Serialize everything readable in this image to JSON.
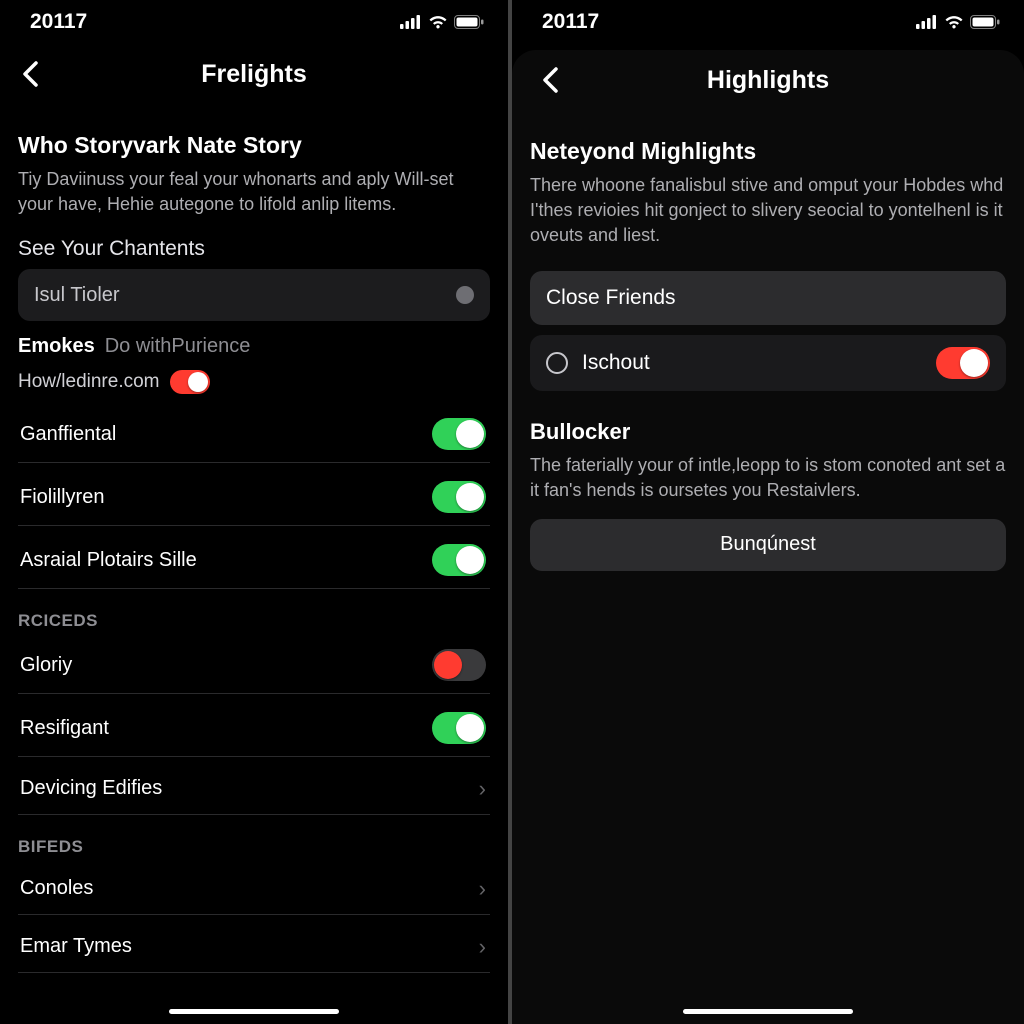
{
  "left": {
    "status_time": "20117",
    "nav_title": "Freliġhts",
    "section1_title": "Who Storyvark Nate Story",
    "section1_desc": "Tiy Daviinuss your feal your whonarts and aply Will-set your have, Hehie autegone to lifold anlip litems.",
    "subhead": "See Your Chantents",
    "cell_isul": "Isul Tioler",
    "emokes_strong": "Emokes",
    "emokes_grey": "Do withPurience",
    "emokes_sub": "How/ledinre.com",
    "toggles": [
      {
        "label": "Ganffiental",
        "on": true
      },
      {
        "label": "Fiolillyren",
        "on": true
      },
      {
        "label": "Asraial Plotairs Sille",
        "on": true
      }
    ],
    "section_rciceds": "RCICEDS",
    "rciceds_rows": [
      {
        "label": "Gloriy",
        "type": "toggle-red"
      },
      {
        "label": "Resifigant",
        "type": "toggle-on"
      },
      {
        "label": "Devicing Edifies",
        "type": "chevron"
      }
    ],
    "section_bifeds": "BIFEDS",
    "bifeds_rows": [
      {
        "label": "Conoles",
        "type": "chevron"
      },
      {
        "label": "Emar Tymes",
        "type": "chevron"
      }
    ]
  },
  "right": {
    "status_time": "20117",
    "nav_title": "Highlights",
    "section1_title": "Neteyond Mighlights",
    "section1_desc": "There whoone fanalisbul stive and omput your Hobdes whd I'thes revioies hit gonject to slivery seocial to yontelhenl is it oveuts and liest.",
    "option_close": "Close Friends",
    "option_ischout": "Ischout",
    "bullocker_title": "Bullocker",
    "bullocker_desc": "The faterially your of intle,leopp to is stom conoted ant set a it fan's hends is oursetes you Restaivlers.",
    "button": "Bunqúnest"
  }
}
